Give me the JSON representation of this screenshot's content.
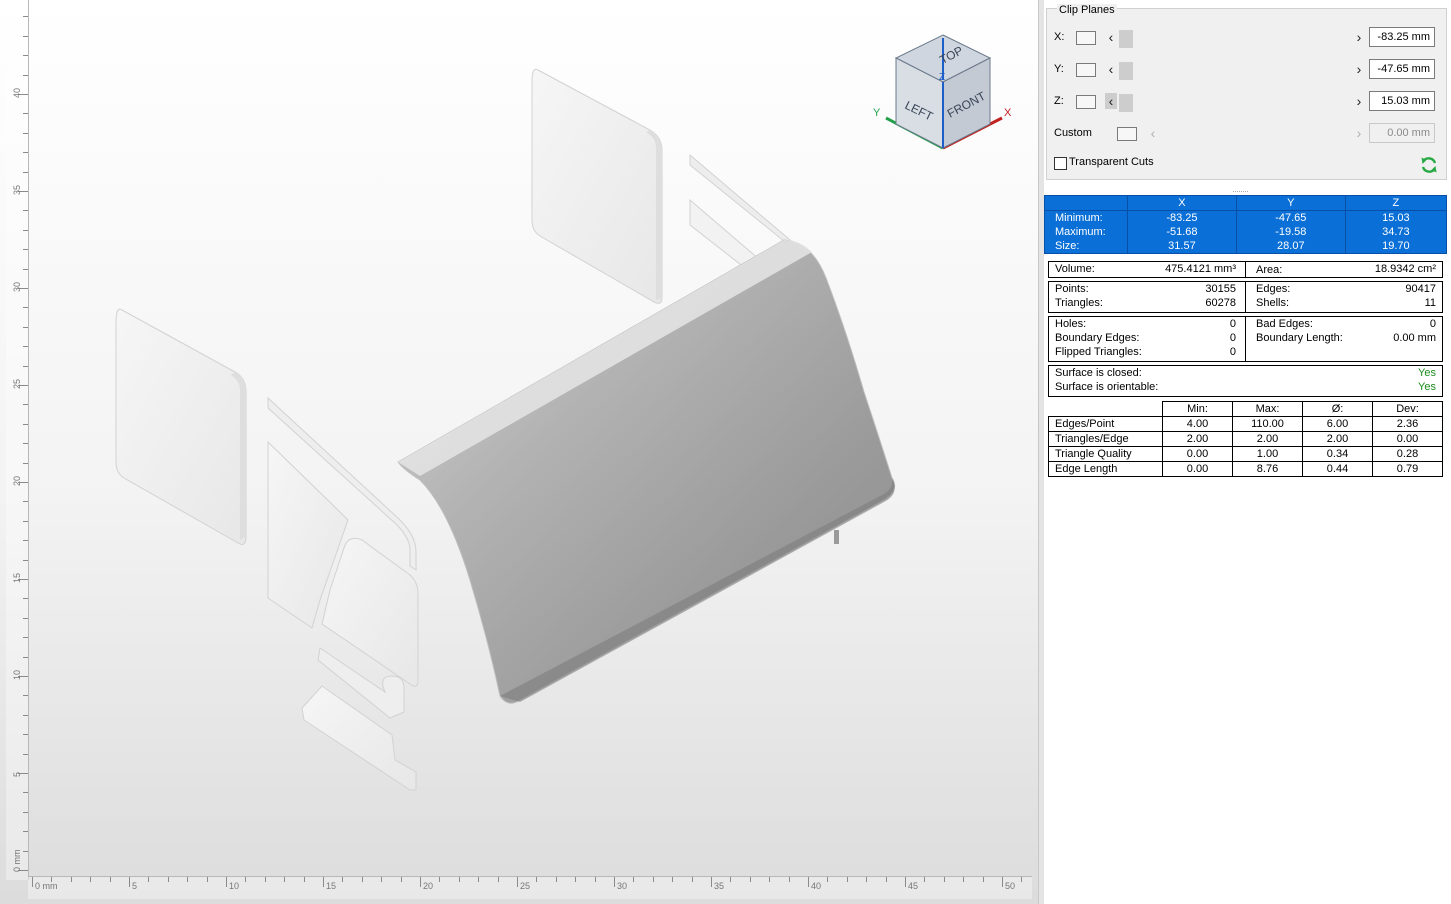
{
  "viewport": {
    "rulers": {
      "vertical_labels": [
        "40",
        "35",
        "30",
        "25",
        "20",
        "15",
        "10",
        "5",
        "0 mm"
      ],
      "horizontal_labels": [
        "0 mm",
        "5",
        "10",
        "15",
        "20",
        "25",
        "30",
        "35",
        "40",
        "45",
        "50"
      ]
    },
    "viewcube": {
      "top": "TOP",
      "left": "LEFT",
      "front": "FRONT",
      "axis_y": "Y",
      "axis_x": "X",
      "axis_z": "Z"
    }
  },
  "clip_planes": {
    "title": "Clip Planes",
    "rows": [
      {
        "label": "X:",
        "value": "-83.25 mm"
      },
      {
        "label": "Y:",
        "value": "-47.65 mm"
      },
      {
        "label": "Z:",
        "value": "15.03 mm"
      },
      {
        "label": "Custom",
        "value": "0.00 mm"
      }
    ],
    "transparent_cuts": "Transparent Cuts"
  },
  "bbox": {
    "headers": [
      "X",
      "Y",
      "Z"
    ],
    "rows": [
      {
        "label": "Minimum:",
        "x": "-83.25",
        "y": "-47.65",
        "z": "15.03"
      },
      {
        "label": "Maximum:",
        "x": "-51.68",
        "y": "-19.58",
        "z": "34.73"
      },
      {
        "label": "Size:",
        "x": "31.57",
        "y": "28.07",
        "z": "19.70"
      }
    ]
  },
  "measures": {
    "volume_label": "Volume:",
    "volume_value": "475.4121 mm³",
    "area_label": "Area:",
    "area_value": "18.9342 cm²"
  },
  "topology": {
    "points_label": "Points:",
    "points_value": "30155",
    "triangles_label": "Triangles:",
    "triangles_value": "60278",
    "edges_label": "Edges:",
    "edges_value": "90417",
    "shells_label": "Shells:",
    "shells_value": "11"
  },
  "errors": {
    "holes_label": "Holes:",
    "holes_value": "0",
    "boundary_edges_label": "Boundary Edges:",
    "boundary_edges_value": "0",
    "flipped_label": "Flipped Triangles:",
    "flipped_value": "0",
    "bad_edges_label": "Bad Edges:",
    "bad_edges_value": "0",
    "boundary_length_label": "Boundary Length:",
    "boundary_length_value": "0.00 mm"
  },
  "surface": {
    "closed_label": "Surface is closed:",
    "closed_value": "Yes",
    "orientable_label": "Surface is orientable:",
    "orientable_value": "Yes"
  },
  "stats": {
    "headers": [
      "Min:",
      "Max:",
      "Ø:",
      "Dev:"
    ],
    "rows": [
      {
        "label": "Edges/Point",
        "min": "4.00",
        "max": "110.00",
        "avg": "6.00",
        "dev": "2.36"
      },
      {
        "label": "Triangles/Edge",
        "min": "2.00",
        "max": "2.00",
        "avg": "2.00",
        "dev": "0.00"
      },
      {
        "label": "Triangle Quality",
        "min": "0.00",
        "max": "1.00",
        "avg": "0.34",
        "dev": "0.28"
      },
      {
        "label": "Edge Length",
        "min": "0.00",
        "max": "8.76",
        "avg": "0.44",
        "dev": "0.79"
      }
    ]
  },
  "colors": {
    "selection_blue": "#0a6fd6",
    "ok_green": "#1c8c1c",
    "refresh_green": "#27a844"
  },
  "icons": {
    "refresh": "refresh-icon",
    "arrow_left": "chevron-left-icon",
    "arrow_right": "chevron-right-icon"
  }
}
